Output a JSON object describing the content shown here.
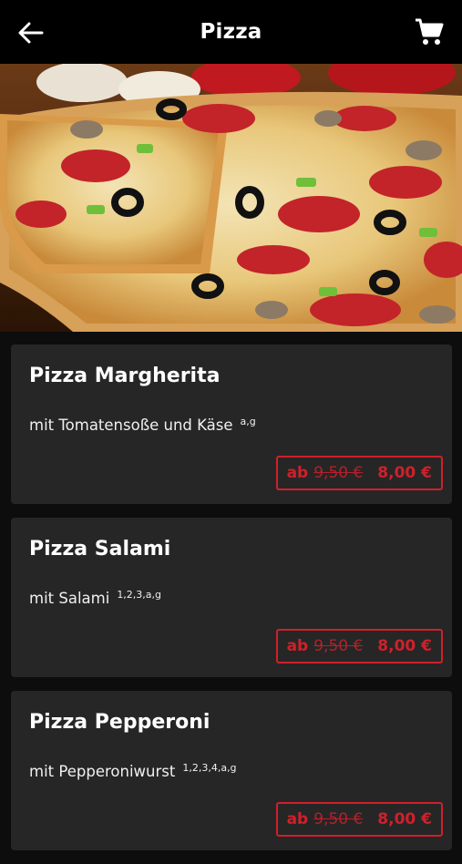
{
  "header": {
    "title": "Pizza",
    "back_icon": "arrow-left-icon",
    "cart_icon": "shopping-cart-icon"
  },
  "colors": {
    "accent": "#d0202a",
    "card_bg": "#262626",
    "page_bg": "#0d0d0d"
  },
  "hero": {
    "image": "pizza-photo"
  },
  "products": [
    {
      "name": "Pizza Margherita",
      "description": "mit Tomatensoße und Käse",
      "allergens": "a,g",
      "prefix": "ab",
      "old_price": "9,50 €",
      "price": "8,00 €"
    },
    {
      "name": "Pizza Salami",
      "description": "mit Salami",
      "allergens": "1,2,3,a,g",
      "prefix": "ab",
      "old_price": "9,50 €",
      "price": "8,00 €"
    },
    {
      "name": "Pizza Pepperoni",
      "description": "mit Pepperoniwurst",
      "allergens": "1,2,3,4,a,g",
      "prefix": "ab",
      "old_price": "9,50 €",
      "price": "8,00 €"
    }
  ]
}
